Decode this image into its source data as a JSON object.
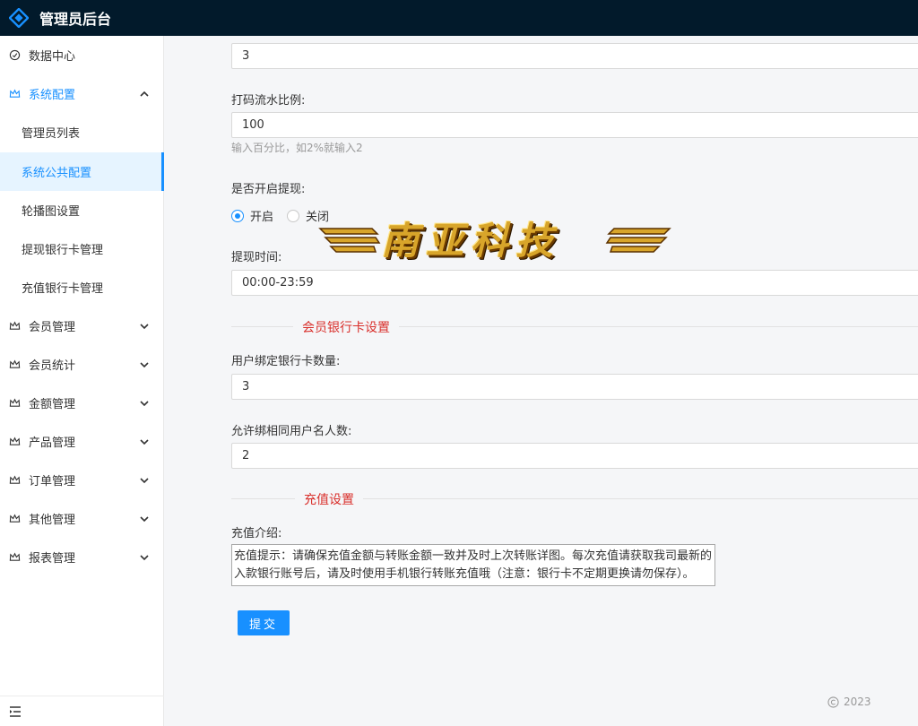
{
  "header": {
    "title": "管理员后台"
  },
  "sidebar": {
    "items": [
      {
        "label": "数据中心"
      },
      {
        "label": "系统配置"
      },
      {
        "label": "会员管理"
      },
      {
        "label": "会员统计"
      },
      {
        "label": "金额管理"
      },
      {
        "label": "产品管理"
      },
      {
        "label": "订单管理"
      },
      {
        "label": "其他管理"
      },
      {
        "label": "报表管理"
      }
    ],
    "sub_items": [
      {
        "label": "管理员列表"
      },
      {
        "label": "系统公共配置"
      },
      {
        "label": "轮播图设置"
      },
      {
        "label": "提现银行卡管理"
      },
      {
        "label": "充值银行卡管理"
      }
    ]
  },
  "form": {
    "top_value": "3",
    "turnover_label": "打码流水比例:",
    "turnover_value": "100",
    "turnover_hint": "输入百分比，如2%就输入2",
    "withdraw_label": "是否开启提现:",
    "withdraw_on": "开启",
    "withdraw_off": "关闭",
    "withdraw_time_label": "提现时间:",
    "withdraw_time_value": "00:00-23:59",
    "section_bank": "会员银行卡设置",
    "bind_count_label": "用户绑定银行卡数量:",
    "bind_count_value": "3",
    "same_name_label": "允许绑相同用户名人数:",
    "same_name_value": "2",
    "section_recharge": "充值设置",
    "recharge_intro_label": "充值介绍:",
    "recharge_intro_value": "充值提示：请确保充值金额与转账金额一致并及时上次转账详图。每次充值请获取我司最新的入款银行账号后，请及时使用手机银行转账充值哦（注意：银行卡不定期更换请勿保存）。",
    "submit_label": "提交"
  },
  "footer": {
    "copyright": "2023"
  },
  "watermark": {
    "text": "南亚科技"
  },
  "colors": {
    "accent": "#1890ff",
    "header_bg": "#021a2b",
    "section_title": "#d9302c"
  }
}
